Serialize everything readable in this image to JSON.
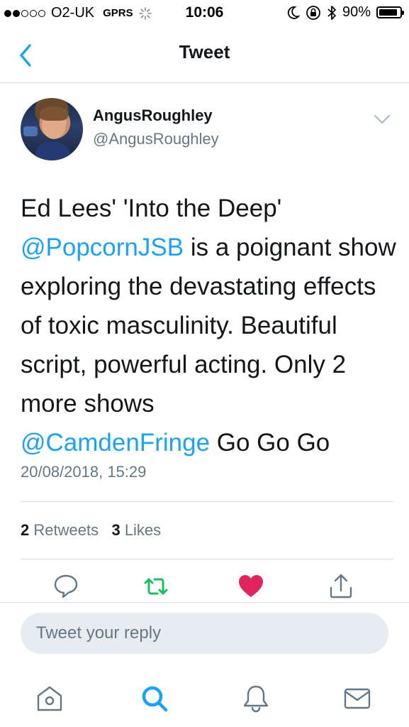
{
  "status_bar": {
    "carrier": "O2-UK",
    "network": "GPRS",
    "time": "10:06",
    "battery_percent_label": "90%",
    "battery_level": 0.9,
    "signal_bars_filled": 2,
    "signal_bars_total": 5
  },
  "nav": {
    "title": "Tweet",
    "back_icon": "chevron-left-icon"
  },
  "tweet": {
    "display_name": "AngusRoughley",
    "handle": "@AngusRoughley",
    "body": {
      "part1": "Ed Lees' 'Into the Deep'",
      "mention1": "@PopcornJSB",
      "part2": " is a poignant show exploring the devastating effects of toxic masculinity. Beautiful script, powerful acting. Only 2 more shows",
      "mention2": "@CamdenFringe",
      "part3": " Go Go Go"
    },
    "timestamp": "20/08/2018, 15:29",
    "retweets_count": "2",
    "retweets_label": "Retweets",
    "likes_count": "3",
    "likes_label": "Likes"
  },
  "actions": {
    "reply_icon": "reply-bubble-icon",
    "retweet_icon": "retweet-icon",
    "like_icon": "heart-icon",
    "share_icon": "share-icon"
  },
  "reply": {
    "placeholder": "Tweet your reply"
  },
  "tabs": [
    {
      "icon": "home-icon",
      "active": false
    },
    {
      "icon": "search-icon",
      "active": true
    },
    {
      "icon": "notifications-bell-icon",
      "active": false
    },
    {
      "icon": "messages-envelope-icon",
      "active": false
    }
  ],
  "colors": {
    "accent": "#1da1f2",
    "retweet_active": "#17bf63",
    "like_active": "#e0245e",
    "secondary_text": "#657786",
    "divider": "#d8dde1"
  }
}
